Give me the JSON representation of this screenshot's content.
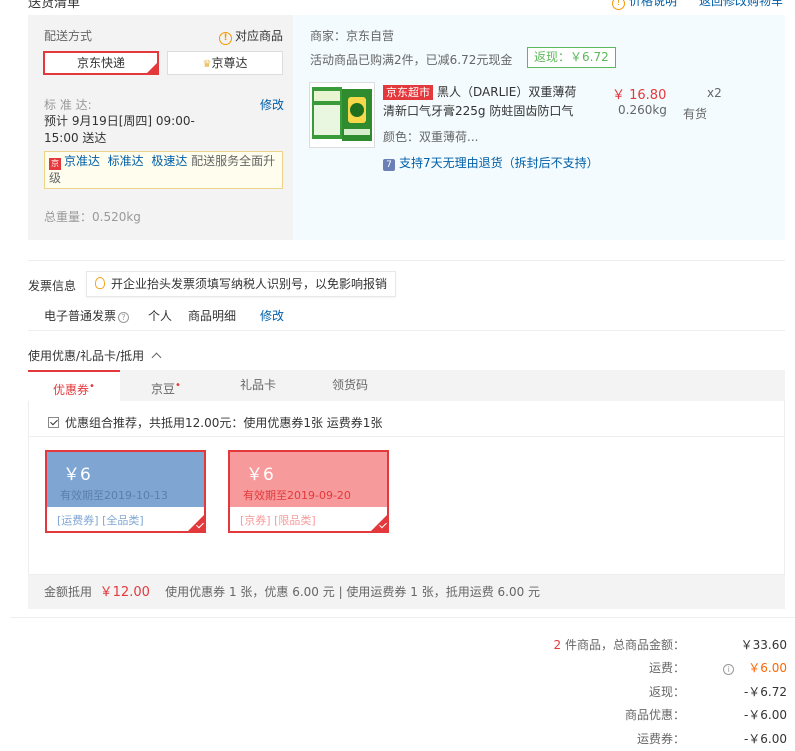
{
  "header": {
    "title": "送货清单",
    "price_note": "价格说明",
    "back_cart": "返回修改购物车"
  },
  "shipping": {
    "method_label": "配送方式",
    "matching_goods": "对应商品",
    "option_jd_express": "京东快递",
    "option_jd_zunda": "京尊达",
    "standard_label": "标 准 达:",
    "modify": "修改",
    "schedule_line1": "预计 9月19日[周四] 09:00-",
    "schedule_line2": "15:00 送达",
    "promo_links": [
      "京准达",
      "标准达",
      "极速达"
    ],
    "promo_text_a": "配送服务全面升",
    "promo_text_b": "级",
    "total_weight": "总重量：0.520kg"
  },
  "order": {
    "merchant": "商家：京东自营",
    "activity": "活动商品已购满2件，已减6.72元现金",
    "rebate": "返现：￥6.72",
    "tag": "京东超市",
    "title_line1": "黑人（DARLIE）双重薄荷",
    "title_line2": "清新口气牙膏225g 防蛀固齿防口气",
    "price": "￥ 16.80",
    "weight": "0.260kg",
    "qty": "x2",
    "stock": "有货",
    "color": "颜色：双重薄荷...",
    "refund": "支持7天无理由退货（拆封后不支持）"
  },
  "invoice": {
    "label": "发票信息",
    "tip": "开企业抬头发票须填写纳税人识别号，以免影响报销",
    "type": "电子普通发票",
    "person": "个人",
    "detail": "商品明细",
    "modify": "修改"
  },
  "coupons": {
    "section_title": "使用优惠/礼品卡/抵用",
    "tabs": [
      {
        "label": "优惠券",
        "dot": "•"
      },
      {
        "label": "京豆",
        "dot": "•"
      },
      {
        "label": "礼品卡",
        "dot": ""
      },
      {
        "label": "领货码",
        "dot": ""
      }
    ],
    "recommend": "优惠组合推荐，共抵用12.00元：使用优惠券1张 运费券1张",
    "items": [
      {
        "amount": "￥6",
        "expire": "有效期至2019-10-13",
        "tags": "[运费券] [全品类]"
      },
      {
        "amount": "￥6",
        "expire": "有效期至2019-09-20",
        "tags": "[京券] [限品类]"
      }
    ],
    "summary_label": "金额抵用",
    "summary_amount": "￥12.00",
    "summary_detail": "使用优惠券 1 张，优惠 6.00 元 | 使用运费券 1 张，抵用运费 6.00 元"
  },
  "totals": {
    "count": "2",
    "count_suffix": "件商品，总商品金额：",
    "goods_amount": "￥33.60",
    "freight_label": "运费：",
    "freight": "￥6.00",
    "rebate_label": "返现：",
    "rebate": "-￥6.72",
    "discount_label": "商品优惠：",
    "discount": "-￥6.00",
    "freight_coupon_label": "运费券：",
    "freight_coupon": "-￥6.00"
  },
  "colors": {
    "accent_red": "#e4393c",
    "link_blue": "#005ea7",
    "rebate_green": "#5cb85c"
  }
}
